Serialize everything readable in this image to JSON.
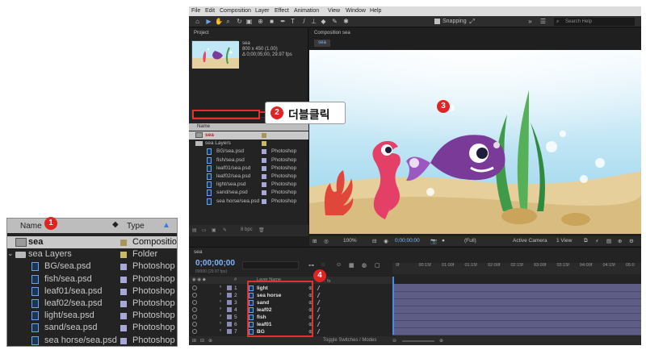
{
  "zoom_panel": {
    "headers": {
      "name": "Name",
      "type": "Type"
    },
    "rows": [
      {
        "name": "sea",
        "type": "Compositio",
        "kind": "comp",
        "selected": true,
        "swatch": "#a8955a"
      },
      {
        "name": "sea Layers",
        "type": "Folder",
        "kind": "folder",
        "swatch": "#c8b86a"
      },
      {
        "name": "BG/sea.psd",
        "type": "Photoshop",
        "kind": "file",
        "swatch": "#a8a8d8"
      },
      {
        "name": "fish/sea.psd",
        "type": "Photoshop",
        "kind": "file",
        "swatch": "#a8a8d8"
      },
      {
        "name": "leaf01/sea.psd",
        "type": "Photoshop",
        "kind": "file",
        "swatch": "#a8a8d8"
      },
      {
        "name": "leaf02/sea.psd",
        "type": "Photoshop",
        "kind": "file",
        "swatch": "#a8a8d8"
      },
      {
        "name": "light/sea.psd",
        "type": "Photoshop",
        "kind": "file",
        "swatch": "#a8a8d8"
      },
      {
        "name": "sand/sea.psd",
        "type": "Photoshop",
        "kind": "file",
        "swatch": "#a8a8d8"
      },
      {
        "name": "sea horse/sea.psd",
        "type": "Photoshop",
        "kind": "file",
        "swatch": "#a8a8d8"
      }
    ]
  },
  "badges": {
    "b1": "1",
    "b2": "2",
    "b3": "3",
    "b4": "4"
  },
  "callout_text": "더블클릭",
  "menu": [
    "File",
    "Edit",
    "Composition",
    "Layer",
    "Effect",
    "Animation",
    "View",
    "Window",
    "Help"
  ],
  "toolbar": {
    "snapping": "Snapping",
    "search_placeholder": "Search Help"
  },
  "project": {
    "title": "Project",
    "thumb_name": "sea",
    "thumb_size": "800 x 450 (1.00)",
    "thumb_duration": "Δ 0;00;05;00, 29.97 fps",
    "col_name": "Name",
    "rows": [
      {
        "name": "sea",
        "type": "",
        "kind": "comp",
        "selected": true
      },
      {
        "name": "sea Layers",
        "type": "",
        "kind": "folder"
      },
      {
        "name": "BG/sea.psd",
        "type": "Photoshop",
        "kind": "file"
      },
      {
        "name": "fish/sea.psd",
        "type": "Photoshop",
        "kind": "file"
      },
      {
        "name": "leaf01/sea.psd",
        "type": "Photoshop",
        "kind": "file"
      },
      {
        "name": "leaf02/sea.psd",
        "type": "Photoshop",
        "kind": "file"
      },
      {
        "name": "light/sea.psd",
        "type": "Photoshop",
        "kind": "file"
      },
      {
        "name": "sand/sea.psd",
        "type": "Photoshop",
        "kind": "file"
      },
      {
        "name": "sea horse/sea.psd",
        "type": "Photoshop",
        "kind": "file"
      }
    ],
    "bpc": "8 bpc"
  },
  "composition": {
    "title": "Composition sea",
    "tab": "sea",
    "zoom": "100%",
    "timecode": "0;00;00;00",
    "resolution": "(Full)",
    "camera": "Active Camera",
    "views": "1 View"
  },
  "timeline": {
    "tab": "sea",
    "timecode": "0;00;00;00",
    "frames": "00000 (29.97 fps)",
    "col_layer": "Layer Name",
    "ruler": [
      "0f",
      "00:15f",
      "01:00f",
      "01:15f",
      "02:00f",
      "02:15f",
      "03:00f",
      "03:15f",
      "04:00f",
      "04:15f",
      "05:0"
    ],
    "layers": [
      {
        "num": "1",
        "name": "light"
      },
      {
        "num": "2",
        "name": "sea horse"
      },
      {
        "num": "3",
        "name": "sand"
      },
      {
        "num": "4",
        "name": "leaf02"
      },
      {
        "num": "5",
        "name": "fish"
      },
      {
        "num": "6",
        "name": "leaf01"
      },
      {
        "num": "7",
        "name": "BG"
      }
    ],
    "toggle": "Toggle Switches / Modes"
  }
}
